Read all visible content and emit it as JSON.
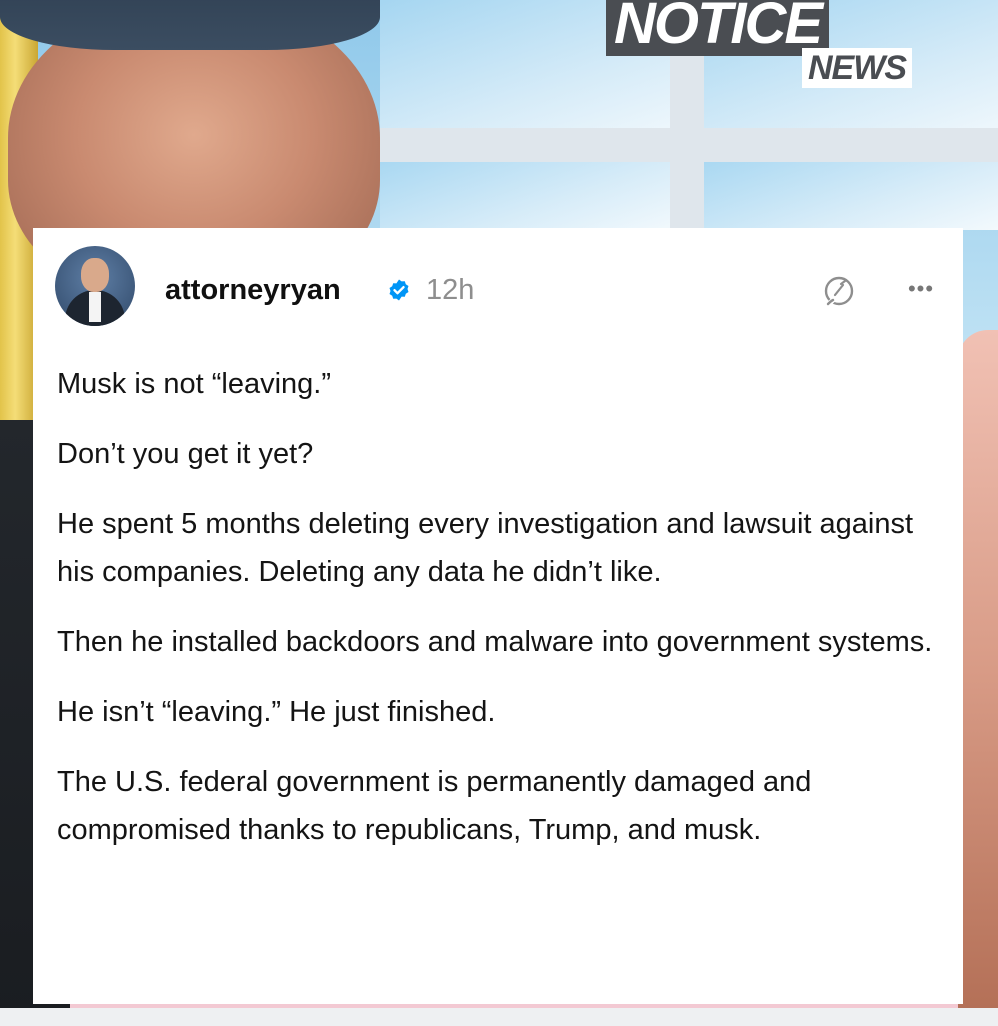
{
  "watermark": {
    "line1": "NOTICE",
    "line2": "NEWS"
  },
  "post": {
    "username": "attorneyryan",
    "verified": true,
    "timestamp": "12h",
    "paragraphs": [
      "Musk is not “leaving.”",
      "Don’t you get it yet?",
      "He spent 5 months deleting every investigation and lawsuit against his companies. Deleting any data he didn’t like.",
      "Then he installed backdoors and malware into government systems.",
      "He isn’t “leaving.” He just finished.",
      "The U.S. federal government is permanently damaged and compromised thanks to republicans, Trump, and musk."
    ],
    "more_label": "•••"
  },
  "colors": {
    "verified_badge": "#0095f6",
    "watermark_dark": "#4a4d52"
  },
  "icons": {
    "threads": "threads-icon",
    "verified": "verified-badge-icon",
    "more": "more-options-icon"
  }
}
